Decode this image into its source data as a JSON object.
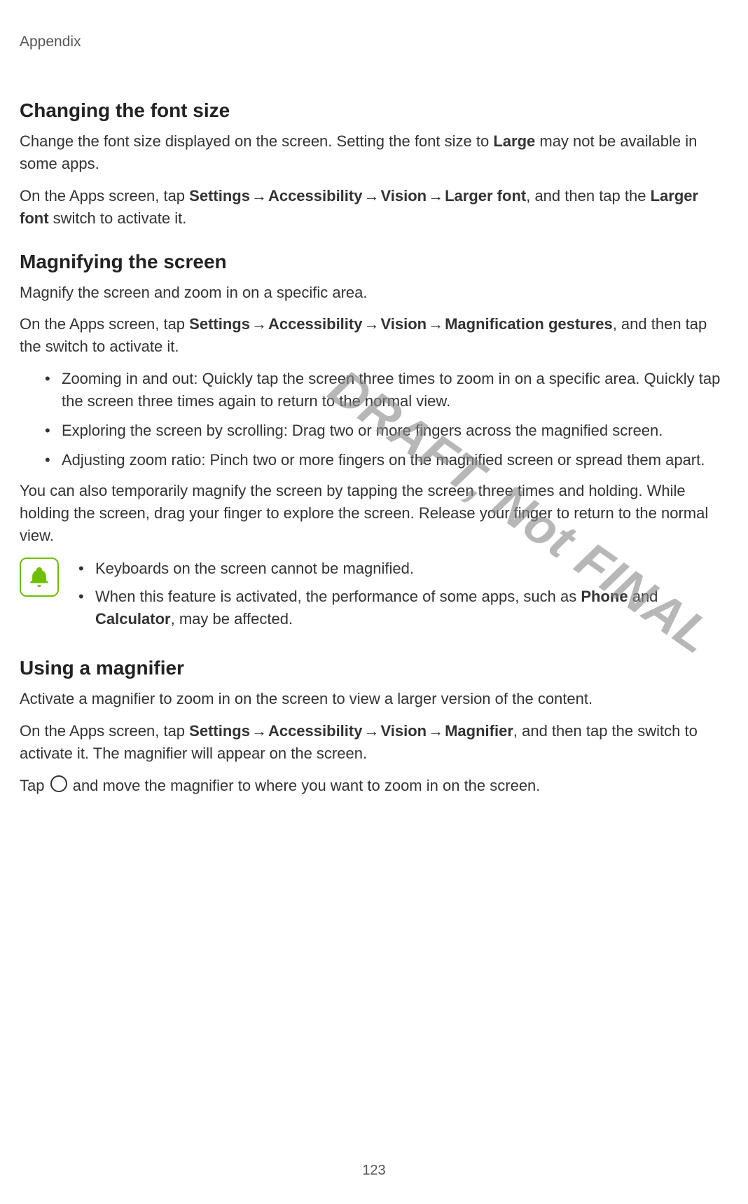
{
  "header": "Appendix",
  "watermark": "DRAFT, Not FINAL",
  "pageNumber": "123",
  "tapCircleAria": "tap circle button",
  "sections": {
    "fontSize": {
      "title": "Changing the font size",
      "p1_a": "Change the font size displayed on the screen. Setting the font size to ",
      "p1_bold": "Large",
      "p1_b": " may not be available in some apps.",
      "p2_a": "On the Apps screen, tap ",
      "p2_settings": "Settings",
      "p2_access": "Accessibility",
      "p2_vision": "Vision",
      "p2_larger": "Larger font",
      "p2_b": ", and then tap the ",
      "p2_larger2": "Larger font",
      "p2_c": " switch to activate it."
    },
    "magnify": {
      "title": "Magnifying the screen",
      "p1": "Magnify the screen and zoom in on a specific area.",
      "p2_a": "On the Apps screen, tap ",
      "p2_settings": "Settings",
      "p2_access": "Accessibility",
      "p2_vision": "Vision",
      "p2_gest": "Magnification gestures",
      "p2_b": ", and then tap the switch to activate it.",
      "bullets": [
        "Zooming in and out: Quickly tap the screen three times to zoom in on a specific area. Quickly tap the screen three times again to return to the normal view.",
        "Exploring the screen by scrolling: Drag two or more fingers across the magnified screen.",
        "Adjusting zoom ratio: Pinch two or more fingers on the magnified screen or spread them apart."
      ],
      "p3": "You can also temporarily magnify the screen by tapping the screen three times and holding. While holding the screen, drag your finger to explore the screen. Release your finger to return to the normal view.",
      "note1": "Keyboards on the screen cannot be magnified.",
      "note2_a": "When this feature is activated, the performance of some apps, such as ",
      "note2_phone": "Phone",
      "note2_and": " and ",
      "note2_calc": "Calculator",
      "note2_b": ", may be affected."
    },
    "magnifier": {
      "title": "Using a magnifier",
      "p1": "Activate a magnifier to zoom in on the screen to view a larger version of the content.",
      "p2_a": "On the Apps screen, tap ",
      "p2_settings": "Settings",
      "p2_access": "Accessibility",
      "p2_vision": "Vision",
      "p2_mag": "Magnifier",
      "p2_b": ", and then tap the switch to activate it. The magnifier will appear on the screen.",
      "p3_a": "Tap ",
      "p3_b": " and move the magnifier to where you want to zoom in on the screen."
    }
  },
  "arrow": "→"
}
